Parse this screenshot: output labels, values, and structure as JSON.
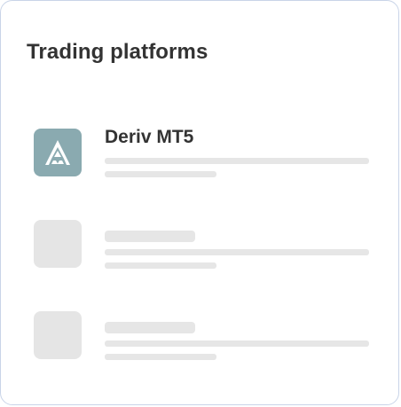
{
  "card": {
    "title": "Trading platforms"
  },
  "platforms": [
    {
      "name": "Deriv MT5",
      "icon": "deriv-mt5-logo-icon"
    },
    {
      "name": "",
      "icon": "placeholder-tile"
    },
    {
      "name": "",
      "icon": "placeholder-tile"
    }
  ],
  "colors": {
    "logo_background": "#8aaab0",
    "skeleton": "#e6e6e6",
    "border": "#c9d4e8",
    "text": "#333333"
  }
}
